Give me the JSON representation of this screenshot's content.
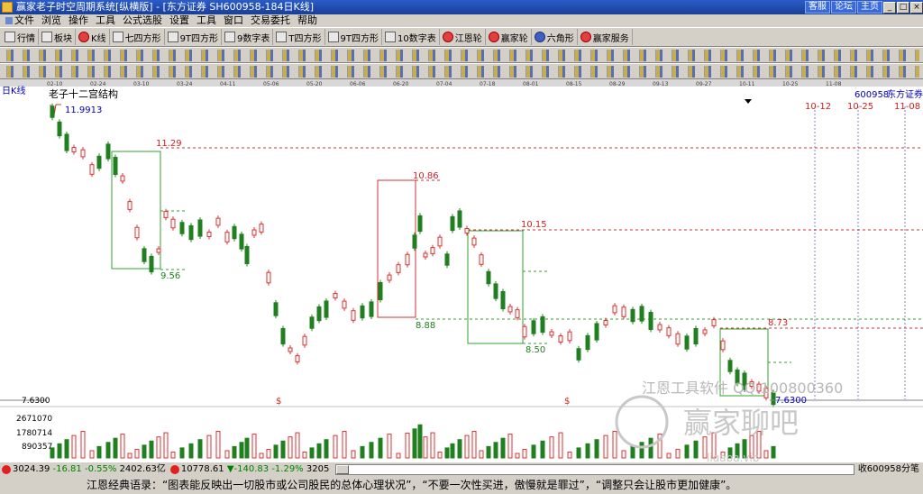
{
  "window": {
    "title": "赢家老子时空周期系统[纵横版] - [东方证券  SH600958-184日K线]",
    "top_links": [
      "客服",
      "论坛",
      "主页"
    ],
    "buttons": [
      "_",
      "□",
      "×"
    ]
  },
  "menu": [
    "文件",
    "浏览",
    "操作",
    "工具",
    "公式选股",
    "设置",
    "工具",
    "窗口",
    "交易委托",
    "帮助"
  ],
  "toolbar": {
    "items": [
      {
        "label": "行情",
        "icon": "quote-icon"
      },
      {
        "label": "板块",
        "icon": "sector-icon"
      },
      {
        "label": "K线",
        "icon": "kline-icon"
      },
      {
        "label": "七四方形",
        "icon": "square-icon"
      },
      {
        "label": "9T四方形",
        "icon": "square-icon"
      },
      {
        "label": "9数字表",
        "icon": "number-table-icon"
      },
      {
        "label": "T四方形",
        "icon": "square-icon"
      },
      {
        "label": "9T四方形",
        "icon": "square-icon"
      },
      {
        "label": "10数字表",
        "icon": "number-table-icon"
      },
      {
        "label": "江恩轮",
        "icon": "gann-wheel-icon"
      },
      {
        "label": "赢家轮",
        "icon": "winner-wheel-icon"
      },
      {
        "label": "六角形",
        "icon": "hexagon-icon"
      },
      {
        "label": "赢家服务",
        "icon": "service-icon"
      }
    ]
  },
  "chart": {
    "period_label": "日K线",
    "indicator_label": "老子十二宫结构",
    "stock_code": "600958",
    "stock_name": "东方证券",
    "date_ticks": [
      "02-10",
      "02-24",
      "03-10",
      "03-24",
      "04-11",
      "05-06",
      "05-20",
      "06-06",
      "06-20",
      "07-04",
      "07-18",
      "08-01",
      "08-15",
      "08-29",
      "09-13",
      "09-27",
      "10-11",
      "10-25",
      "11-08"
    ],
    "future_dates": [
      "10-12",
      "10-25",
      "11-08"
    ],
    "price_labels": {
      "high": "11.9913",
      "box1_top": "11.29",
      "box1_bottom": "9.56",
      "box2_top": "10.86",
      "box2_bottom": "8.88",
      "box3_top": "10.15",
      "box3_bottom": "8.50",
      "box4_top": "8.73",
      "low": "7.6300",
      "axis_low": "7.6300"
    },
    "volume_ticks": [
      "2671070",
      "1780714",
      "890357"
    ],
    "markers": [
      "$",
      "$"
    ],
    "watermark": {
      "tool": "江恩工具软件 QQ:100800360",
      "brand": "赢家聊吧",
      "site": "ligapa.vip"
    },
    "colors": {
      "up": "#e03030",
      "down": "#208020",
      "box_green": "#30a030",
      "box_red": "#d03030",
      "date_blue": "#0000c0"
    }
  },
  "status": {
    "sh_value": "3024.39",
    "sh_change": "-16.81",
    "sh_pct": "-0.55%",
    "sh_amount": "2402.63亿",
    "sz_value": "10778.61",
    "sz_change": "▼-140.83",
    "sz_pct": "-1.29%",
    "sz_amount": "3205",
    "receive": "收600958分笔"
  },
  "quote": "江恩经典语录：“图表能反映出一切股市或公司股民的总体心理状况”，“不要一次性买进，傲慢就是罪过”，“调整只会让股市更加健康”。"
}
